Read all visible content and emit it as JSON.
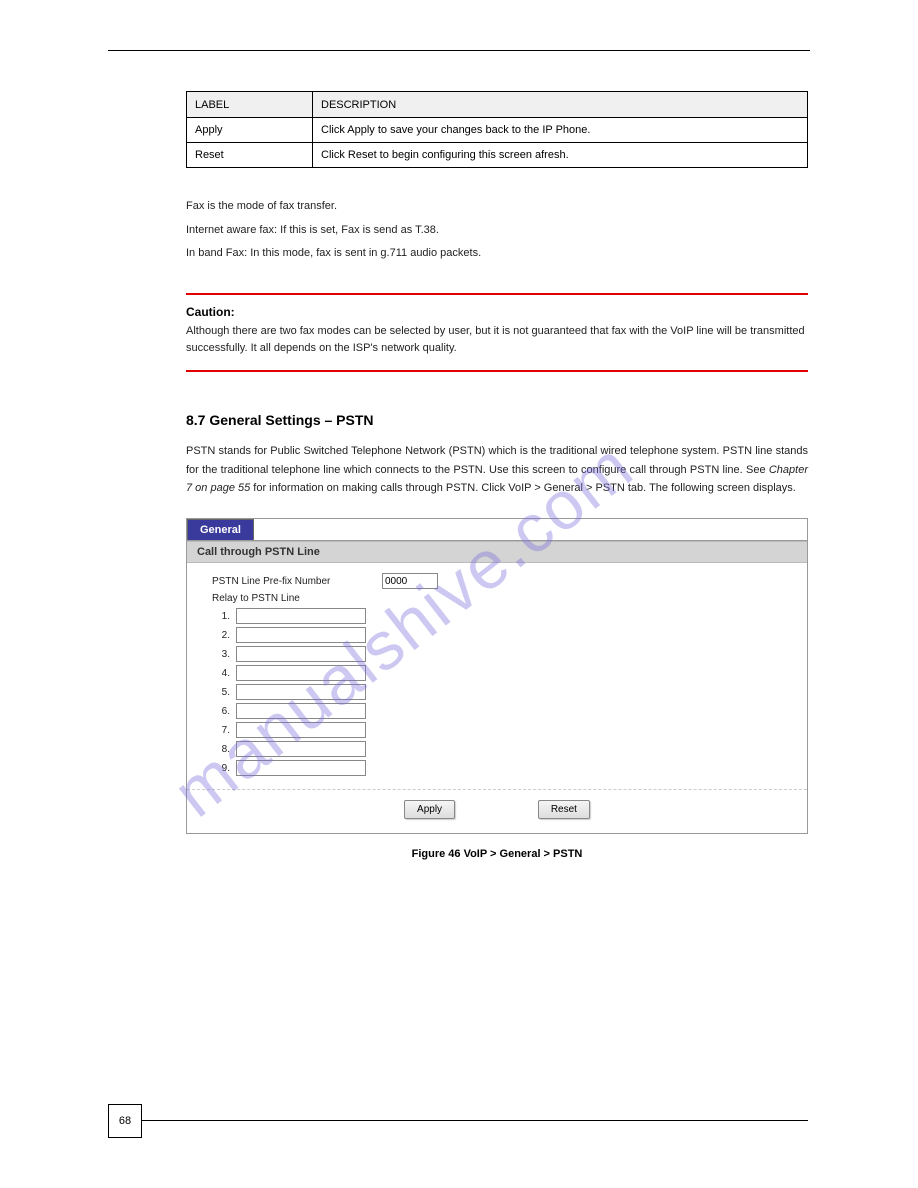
{
  "watermark": "manualshive.com",
  "table": {
    "headers": [
      "LABEL",
      "DESCRIPTION"
    ],
    "rows": [
      [
        "Apply",
        "Click Apply to save your changes back to the IP Phone."
      ],
      [
        "Reset",
        "Click Reset to begin configuring this screen afresh."
      ]
    ]
  },
  "desc": {
    "p1": "Fax is the mode of fax transfer.",
    "p2": "Internet aware fax: If this is set, Fax is send as T.38.",
    "p3": "In band Fax: In this mode, fax is sent in g.711 audio packets."
  },
  "warning": {
    "title": "Caution:",
    "text": "Although there are two fax modes can be selected by user, but it is not guaranteed that fax with the VoIP line will be transmitted successfully. It all depends on the ISP's network quality."
  },
  "section": {
    "heading": "8.7 General Settings – PSTN",
    "para_before_ref": "PSTN stands for Public Switched Telephone Network (PSTN) which is the traditional wired telephone system. PSTN line stands for the traditional telephone line which connects to the PSTN. Use this screen to configure call through PSTN line. See ",
    "ref": "Chapter 7 on page 55",
    "para_after_ref": " for information on making calls through PSTN. Click VoIP > General > PSTN tab. The following screen displays."
  },
  "figure": {
    "tab_label": "General",
    "section_header": "Call through PSTN Line",
    "prefix_label": "PSTN Line Pre-fix Number",
    "prefix_value": "0000",
    "relay_label": "Relay to PSTN Line",
    "relay_nums": [
      "1.",
      "2.",
      "3.",
      "4.",
      "5.",
      "6.",
      "7.",
      "8.",
      "9."
    ],
    "apply_label": "Apply",
    "reset_label": "Reset",
    "caption": "Figure 46 VoIP > General > PSTN"
  },
  "page_number": "68"
}
